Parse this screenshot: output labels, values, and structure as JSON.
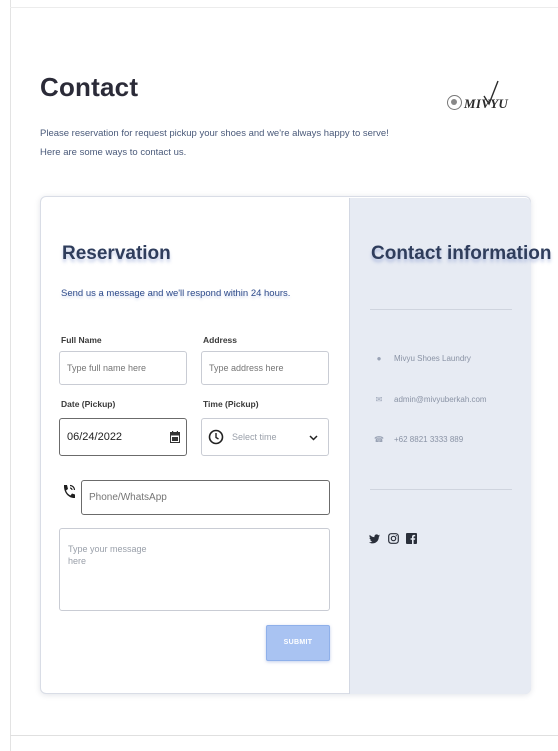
{
  "page": {
    "title": "Contact",
    "intro_line1": "Please reservation for request pickup your shoes and we're always happy to serve!",
    "intro_line2": "Here are some ways to contact us."
  },
  "logo": {
    "text": "MIVYU"
  },
  "reservation": {
    "title": "Reservation",
    "subtitle": "Send us a message and we'll respond within 24 hours.",
    "full_name": {
      "label": "Full Name",
      "placeholder": "Type full name here"
    },
    "address": {
      "label": "Address",
      "placeholder": "Type address here"
    },
    "date": {
      "label": "Date (Pickup)",
      "value": "06/24/2022"
    },
    "time": {
      "label": "Time (Pickup)",
      "placeholder": "Select time"
    },
    "phone": {
      "placeholder": "Phone/WhatsApp"
    },
    "message": {
      "placeholder_line1": "Type your message",
      "placeholder_line2": "here"
    },
    "submit_label": "SUBMIT"
  },
  "contact_info": {
    "title": "Contact information",
    "items": [
      {
        "icon": "location-icon",
        "text": "Mivyu Shoes Laundry"
      },
      {
        "icon": "email-icon",
        "text": "admin@mivyuberkah.com"
      },
      {
        "icon": "phone-icon",
        "text": "+62 8821 3333 889"
      }
    ],
    "social": [
      "twitter-icon",
      "instagram-icon",
      "facebook-icon"
    ]
  },
  "colors": {
    "accent": "#a9c3f2",
    "panel_bg": "#e7ebf3",
    "title_text": "#2f3d5c"
  }
}
